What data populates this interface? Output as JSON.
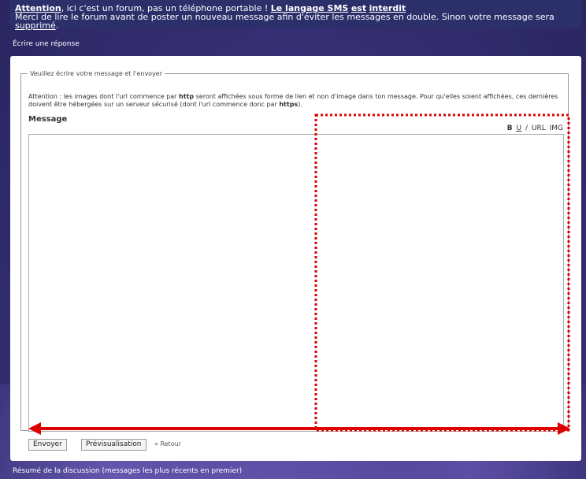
{
  "notice": {
    "line1_attention": "Attention",
    "line1_text": ", ici c'est un forum, pas un téléphone portable !",
    "line1_rule_a": "Le langage SMS",
    "line1_rule_b": "est",
    "line1_rule_c": "interdit",
    "line2_text": "Merci de lire le forum avant de poster un nouveau message afin d'éviter les messages en double. Sinon votre message sera",
    "line2_end": "supprimé"
  },
  "section_title": "Écrire une réponse",
  "form": {
    "legend": "Veuillez écrire votre message et l'envoyer",
    "hint_a": "Attention : les images dont l'url commence par",
    "hint_http": "http",
    "hint_b": "seront affichées sous forme de lien et non d'image dans ton message. Pour qu'elles soient affichées, ces dernières doivent être hébergées sur un serveur sécurisé (dont l'url commence donc par",
    "hint_https": "https",
    "hint_c": ").",
    "message_label": "Message",
    "toolbar": {
      "bold": "B",
      "underline": "U",
      "sep": "/",
      "url": "URL",
      "img": "IMG"
    },
    "textarea_value": "",
    "send_button": "Envoyer",
    "preview_button": "Prévisualisation",
    "back_link": "« Retour"
  },
  "summary_title": "Résumé de la discussion (messages les plus récents en premier)",
  "annotation": {
    "color": "#dd0000"
  }
}
